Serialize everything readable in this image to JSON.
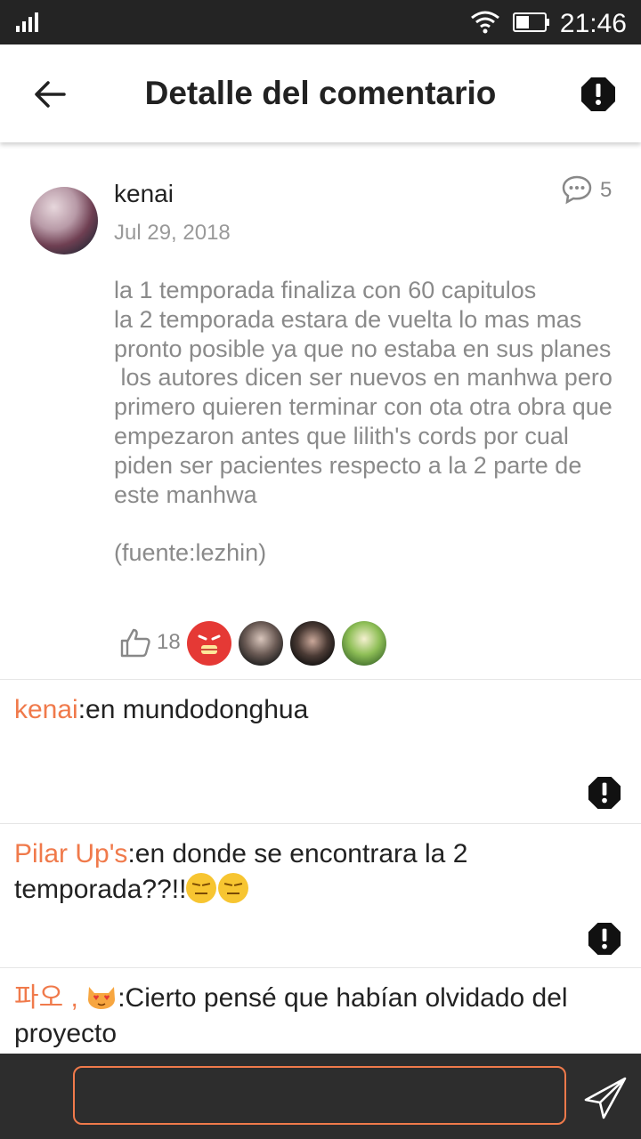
{
  "status_bar": {
    "time": "21:46"
  },
  "header": {
    "title": "Detalle del comentario"
  },
  "comment": {
    "author": "kenai",
    "date": "Jul 29, 2018",
    "reply_count": "5",
    "body": "la 1 temporada finaliza con 60 capitulos\nla 2 temporada estara de vuelta lo mas mas pronto posible ya que no estaba en sus planes\n los autores dicen ser nuevos en manhwa pero primero quieren terminar con ota otra obra que empezaron antes que lilith's cords por cual piden ser pacientes respecto a la 2 parte de este manhwa\n\n(fuente:lezhin)",
    "like_count": "18"
  },
  "replies": [
    {
      "name": "kenai",
      "text": ":en mundodonghua"
    },
    {
      "name": "Pilar Up's",
      "text": ":en donde se encontrara la 2 temporada??!!"
    },
    {
      "name": "파오 , ",
      "text": ":Cierto pensé que habían olvidado  del proyecto"
    }
  ],
  "input": {
    "placeholder": ""
  },
  "colors": {
    "accent": "#f07a4b",
    "status_bar": "#242424",
    "input_bar": "#2d2d2d"
  },
  "icons": [
    "signal-icon",
    "wifi-icon",
    "battery-icon",
    "back-arrow-icon",
    "report-icon",
    "chat-bubble-icon",
    "thumbs-up-icon",
    "send-icon"
  ]
}
